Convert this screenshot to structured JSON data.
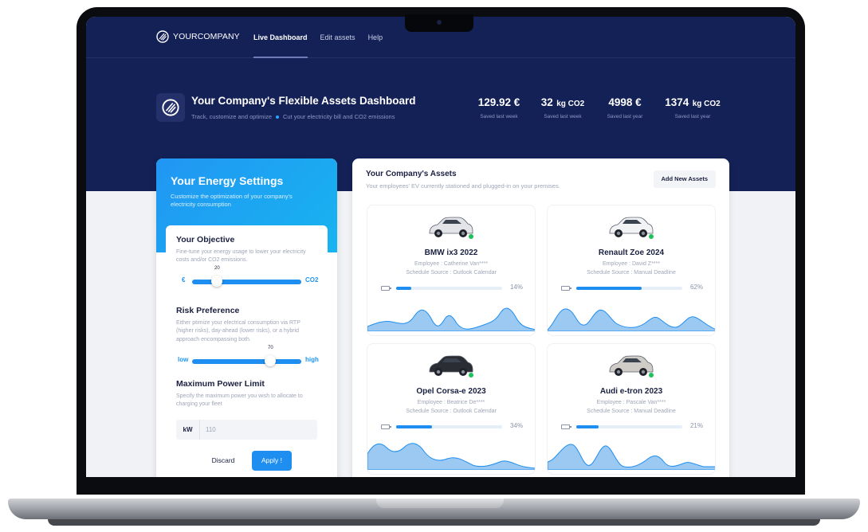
{
  "nav": {
    "brand": "YOURCOMPANY",
    "links": [
      "Live Dashboard",
      "Edit assets",
      "Help"
    ]
  },
  "header": {
    "title": "Your Company's Flexible Assets Dashboard",
    "subtitle_a": "Track, customize and optimize",
    "subtitle_b": "Cut your electricity bill and CO2 emissions",
    "stats": [
      {
        "value": "129.92 €",
        "unit": "",
        "label": "Saved last week"
      },
      {
        "value": "32",
        "unit": "kg CO2",
        "label": "Saved last week"
      },
      {
        "value": "4998 €",
        "unit": "",
        "label": "Saved last year"
      },
      {
        "value": "1374",
        "unit": "kg CO2",
        "label": "Saved last year"
      }
    ]
  },
  "settings": {
    "title": "Your Energy Settings",
    "subtitle": "Customize the optimization of your company's electricity consumption",
    "objective": {
      "title": "Your Objective",
      "desc": "Fine-tune your energy usage to lower your electricity costs and/or CO2 emissions.",
      "left": "€",
      "right": "CO2",
      "value": "20"
    },
    "risk": {
      "title": "Risk Preference",
      "desc": "Either ptimize your electrical consumption via RTP (higher risks), day-ahead (lower risks), or a hybrid approach encompassing both.",
      "left": "low",
      "right": "high",
      "value": "70"
    },
    "power": {
      "title": "Maximum Power Limit",
      "desc": "Specify the maximum power you wish to allocate to charging your fleet",
      "unit": "kW",
      "value": "110"
    },
    "discard": "Discard",
    "apply": "Apply !"
  },
  "assets": {
    "title": "Your Company's Assets",
    "subtitle": "Your employees' EV currently stationed and plugged-in on your premises.",
    "add": "Add New Assets",
    "cards": [
      {
        "name": "BMW ix3 2022",
        "employee": "Employee : Catherine Van****",
        "source": "Schedule Source : Outlook Calendar",
        "percent": "14%",
        "fill": 0.14,
        "color": "#e2e4e8"
      },
      {
        "name": "Renault Zoe 2024",
        "employee": "Employee : David Z****",
        "source": "Schedule Source : Manual Deadline",
        "percent": "62%",
        "fill": 0.62,
        "color": "#f2f3f5"
      },
      {
        "name": "Opel Corsa-e 2023",
        "employee": "Employee : Beatrice De****",
        "source": "Schedule Source : Outlook Calendar",
        "percent": "34%",
        "fill": 0.34,
        "color": "#2a2d33"
      },
      {
        "name": "Audi e-tron 2023",
        "employee": "Employee : Pascale Van****",
        "source": "Schedule Source : Manual Deadline",
        "percent": "21%",
        "fill": 0.21,
        "color": "#cfcbc6"
      }
    ]
  }
}
